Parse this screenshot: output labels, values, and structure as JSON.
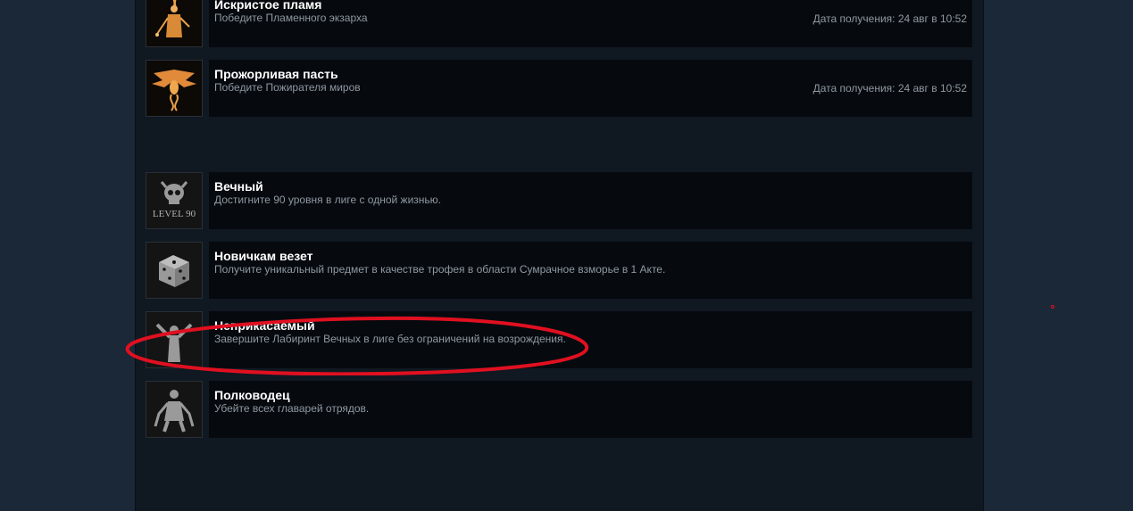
{
  "achievements": [
    {
      "title": "Искристое пламя",
      "description": "Победите Пламенного экзарха",
      "unlock_date": "Дата получения: 24 авг в 10:52",
      "icon": "burning-figure-icon"
    },
    {
      "title": "Прожорливая пасть",
      "description": "Победите Пожирателя миров",
      "unlock_date": "Дата получения: 24 авг в 10:52",
      "icon": "winged-devourer-icon"
    },
    {
      "title": "Вечный",
      "description": "Достигните 90 уровня в лиге с одной жизнью.",
      "icon": "skull-level-icon",
      "icon_text": "LEVEL 90"
    },
    {
      "title": "Новичкам везет",
      "description": "Получите уникальный предмет в качестве трофея в области Сумрачное взморье в 1 Акте.",
      "icon": "dice-icon"
    },
    {
      "title": "Неприкасаемый",
      "description": "Завершите Лабиринт Вечных в лиге без ограничений на возрождения.",
      "icon": "arms-raised-figure-icon"
    },
    {
      "title": "Полководец",
      "description": "Убейте всех главарей отрядов.",
      "icon": "warrior-figure-icon"
    }
  ],
  "colors": {
    "page_background": "#1b2838",
    "panel_background": "#101822",
    "row_background": "#060a0f",
    "title_text": "#ffffff",
    "secondary_text": "#8f98a0",
    "unlocked_icon_accent": "#e8a04a",
    "locked_icon_tone": "#9a9a9a",
    "highlight_annotation": "#e01020"
  }
}
